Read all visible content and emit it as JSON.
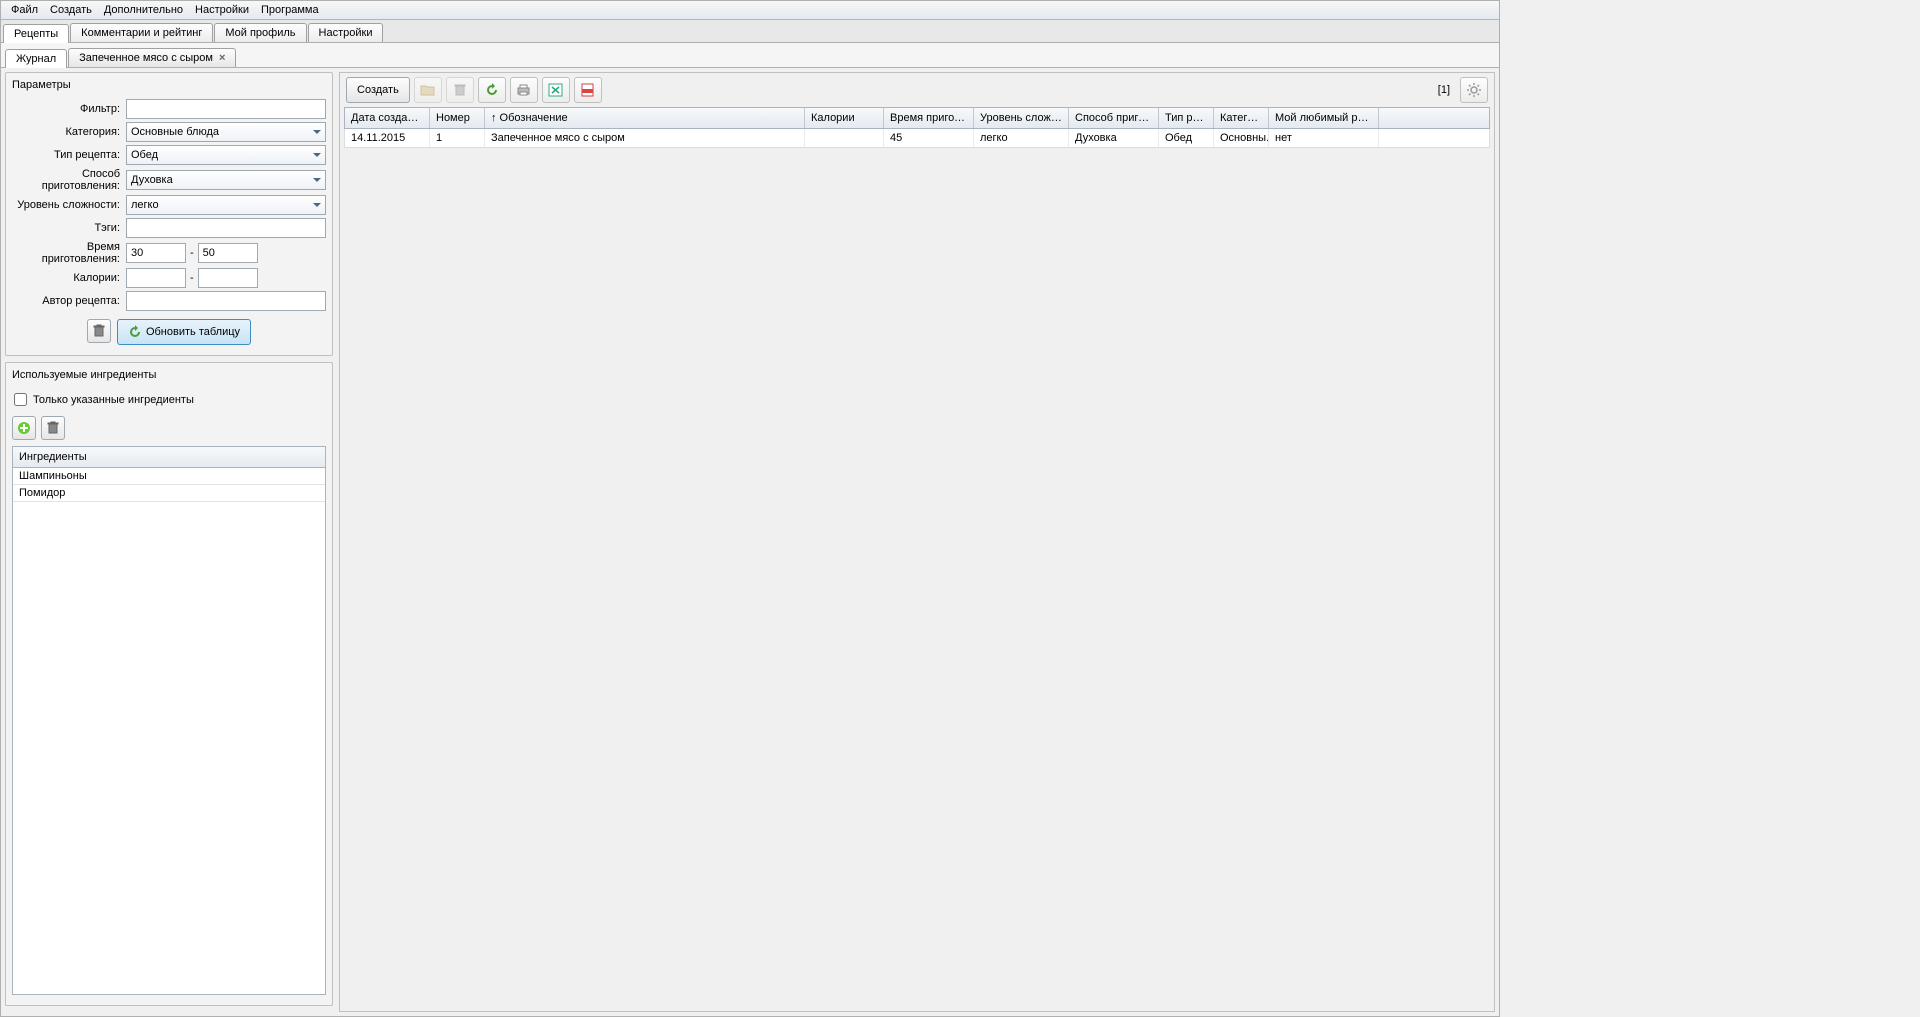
{
  "menu": [
    "Файл",
    "Создать",
    "Дополнительно",
    "Настройки",
    "Программа"
  ],
  "tabs_outer": [
    "Рецепты",
    "Комментарии и рейтинг",
    "Мой профиль",
    "Настройки"
  ],
  "tabs_inner": [
    {
      "label": "Журнал",
      "closable": false,
      "active": true
    },
    {
      "label": "Запеченное мясо с сыром",
      "closable": true,
      "active": false
    }
  ],
  "params": {
    "title": "Параметры",
    "filter_label": "Фильтр:",
    "filter_value": "",
    "category_label": "Категория:",
    "category_value": "Основные блюда",
    "type_label": "Тип рецепта:",
    "type_value": "Обед",
    "method_label": "Способ приготовления:",
    "method_value": "Духовка",
    "difficulty_label": "Уровень сложности:",
    "difficulty_value": "легко",
    "tags_label": "Тэги:",
    "tags_value": "",
    "time_label": "Время приготовления:",
    "time_from": "30",
    "time_to": "50",
    "calories_label": "Калории:",
    "calories_from": "",
    "calories_to": "",
    "author_label": "Автор рецепта:",
    "author_value": "",
    "range_sep": "-",
    "refresh_btn": "Обновить таблицу"
  },
  "ingredients": {
    "title": "Используемые ингредиенты",
    "only_checkbox": "Только указанные ингредиенты",
    "header": "Ингредиенты",
    "rows": [
      "Шампиньоны",
      "Помидор"
    ]
  },
  "toolbar": {
    "create": "Создать",
    "count": "[1]"
  },
  "grid": {
    "headers": [
      "Дата создания",
      "Номер",
      "↑ Обозначение",
      "Калории",
      "Время приготовле...",
      "Уровень сложности",
      "Способ приготовл...",
      "Тип рецепта",
      "Категория",
      "Мой любимый рецепт"
    ],
    "rows": [
      {
        "date": "14.11.2015",
        "num": "1",
        "name": "Запеченное мясо с сыром",
        "cal": "",
        "time": "45",
        "diff": "легко",
        "method": "Духовка",
        "type": "Обед",
        "cat": "Основны...",
        "fav": "нет"
      }
    ]
  }
}
